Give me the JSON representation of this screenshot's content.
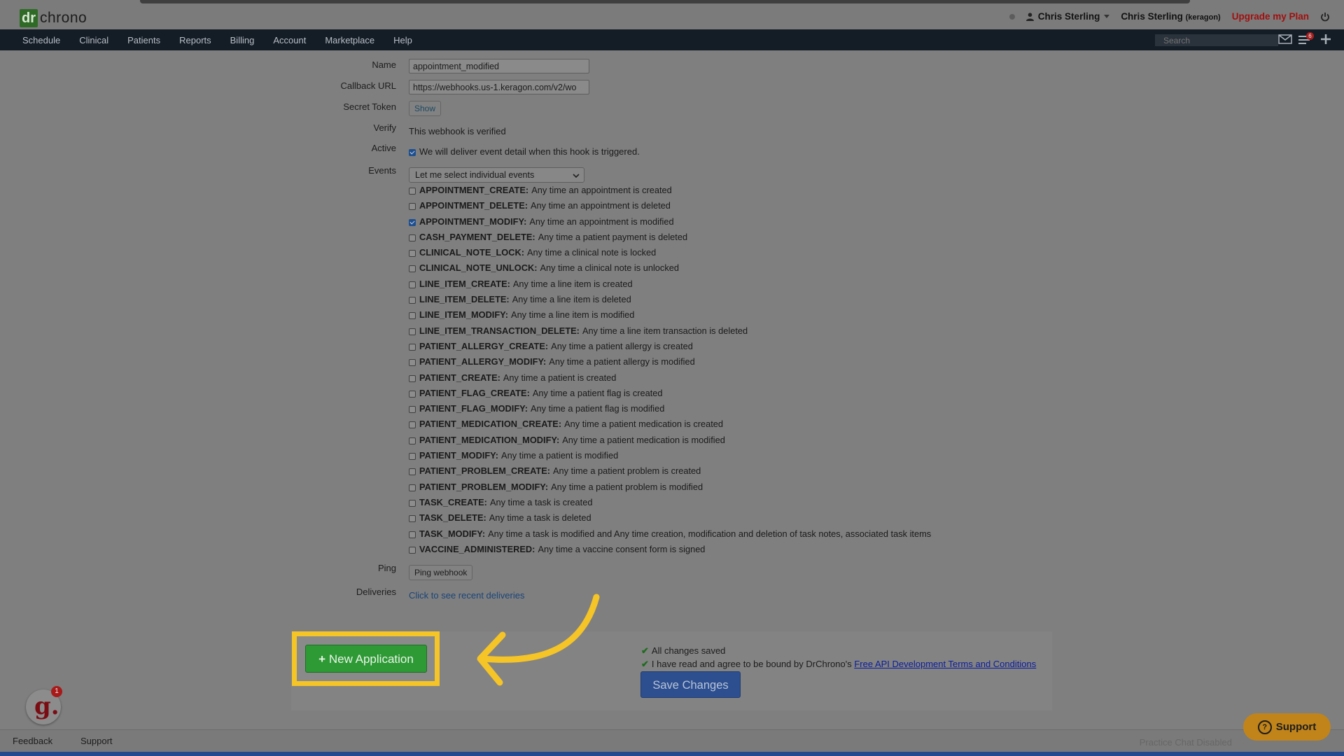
{
  "header": {
    "logo_dr": "dr",
    "logo_text": "chrono",
    "user_name": "Chris Sterling",
    "practice_name": "Chris Sterling",
    "practice_account": "(keragon)",
    "upgrade_label": "Upgrade my Plan"
  },
  "nav": {
    "items": [
      "Schedule",
      "Clinical",
      "Patients",
      "Reports",
      "Billing",
      "Account",
      "Marketplace",
      "Help"
    ],
    "search_placeholder": "Search",
    "notification_count": "6"
  },
  "form": {
    "name_label": "Name",
    "name_value": "appointment_modified",
    "callback_label": "Callback URL",
    "callback_value": "https://webhooks.us-1.keragon.com/v2/wo",
    "secret_label": "Secret Token",
    "show_label": "Show",
    "verify_label": "Verify",
    "verify_text": "This webhook is verified",
    "active_label": "Active",
    "active_text": "We will deliver event detail when this hook is triggered.",
    "events_label": "Events",
    "events_select": "Let me select individual events",
    "events": [
      {
        "name": "APPOINTMENT_CREATE:",
        "desc": "Any time an appointment is created",
        "checked": false
      },
      {
        "name": "APPOINTMENT_DELETE:",
        "desc": "Any time an appointment is deleted",
        "checked": false
      },
      {
        "name": "APPOINTMENT_MODIFY:",
        "desc": "Any time an appointment is modified",
        "checked": true
      },
      {
        "name": "CASH_PAYMENT_DELETE:",
        "desc": "Any time a patient payment is deleted",
        "checked": false
      },
      {
        "name": "CLINICAL_NOTE_LOCK:",
        "desc": "Any time a clinical note is locked",
        "checked": false
      },
      {
        "name": "CLINICAL_NOTE_UNLOCK:",
        "desc": "Any time a clinical note is unlocked",
        "checked": false
      },
      {
        "name": "LINE_ITEM_CREATE:",
        "desc": "Any time a line item is created",
        "checked": false
      },
      {
        "name": "LINE_ITEM_DELETE:",
        "desc": "Any time a line item is deleted",
        "checked": false
      },
      {
        "name": "LINE_ITEM_MODIFY:",
        "desc": "Any time a line item is modified",
        "checked": false
      },
      {
        "name": "LINE_ITEM_TRANSACTION_DELETE:",
        "desc": "Any time a line item transaction is deleted",
        "checked": false
      },
      {
        "name": "PATIENT_ALLERGY_CREATE:",
        "desc": "Any time a patient allergy is created",
        "checked": false
      },
      {
        "name": "PATIENT_ALLERGY_MODIFY:",
        "desc": "Any time a patient allergy is modified",
        "checked": false
      },
      {
        "name": "PATIENT_CREATE:",
        "desc": "Any time a patient is created",
        "checked": false
      },
      {
        "name": "PATIENT_FLAG_CREATE:",
        "desc": "Any time a patient flag is created",
        "checked": false
      },
      {
        "name": "PATIENT_FLAG_MODIFY:",
        "desc": "Any time a patient flag is modified",
        "checked": false
      },
      {
        "name": "PATIENT_MEDICATION_CREATE:",
        "desc": "Any time a patient medication is created",
        "checked": false
      },
      {
        "name": "PATIENT_MEDICATION_MODIFY:",
        "desc": "Any time a patient medication is modified",
        "checked": false
      },
      {
        "name": "PATIENT_MODIFY:",
        "desc": "Any time a patient is modified",
        "checked": false
      },
      {
        "name": "PATIENT_PROBLEM_CREATE:",
        "desc": "Any time a patient problem is created",
        "checked": false
      },
      {
        "name": "PATIENT_PROBLEM_MODIFY:",
        "desc": "Any time a patient problem is modified",
        "checked": false
      },
      {
        "name": "TASK_CREATE:",
        "desc": "Any time a task is created",
        "checked": false
      },
      {
        "name": "TASK_DELETE:",
        "desc": "Any time a task is deleted",
        "checked": false
      },
      {
        "name": "TASK_MODIFY:",
        "desc": "Any time a task is modified and Any time creation, modification and deletion of task notes, associated task items",
        "checked": false
      },
      {
        "name": "VACCINE_ADMINISTERED:",
        "desc": "Any time a vaccine consent form is signed",
        "checked": false
      }
    ],
    "ping_label": "Ping",
    "ping_button": "Ping webhook",
    "deliveries_label": "Deliveries",
    "deliveries_link": "Click to see recent deliveries"
  },
  "bottom": {
    "new_app_label": "New Application",
    "saved_text": "All changes saved",
    "terms_prefix": "I have read and agree to be bound by DrChrono's",
    "terms_link": "Free API Development Terms and Conditions",
    "save_label": "Save Changes"
  },
  "footer": {
    "feedback": "Feedback",
    "support": "Support",
    "chat_disabled": "Practice Chat Disabled",
    "support_button": "Support",
    "g_badge": "1"
  },
  "colors": {
    "highlight": "#f5c427",
    "new_app_green": "#2e9a35",
    "save_blue": "#2d4f8f",
    "upgrade_red": "#a10f0f"
  }
}
